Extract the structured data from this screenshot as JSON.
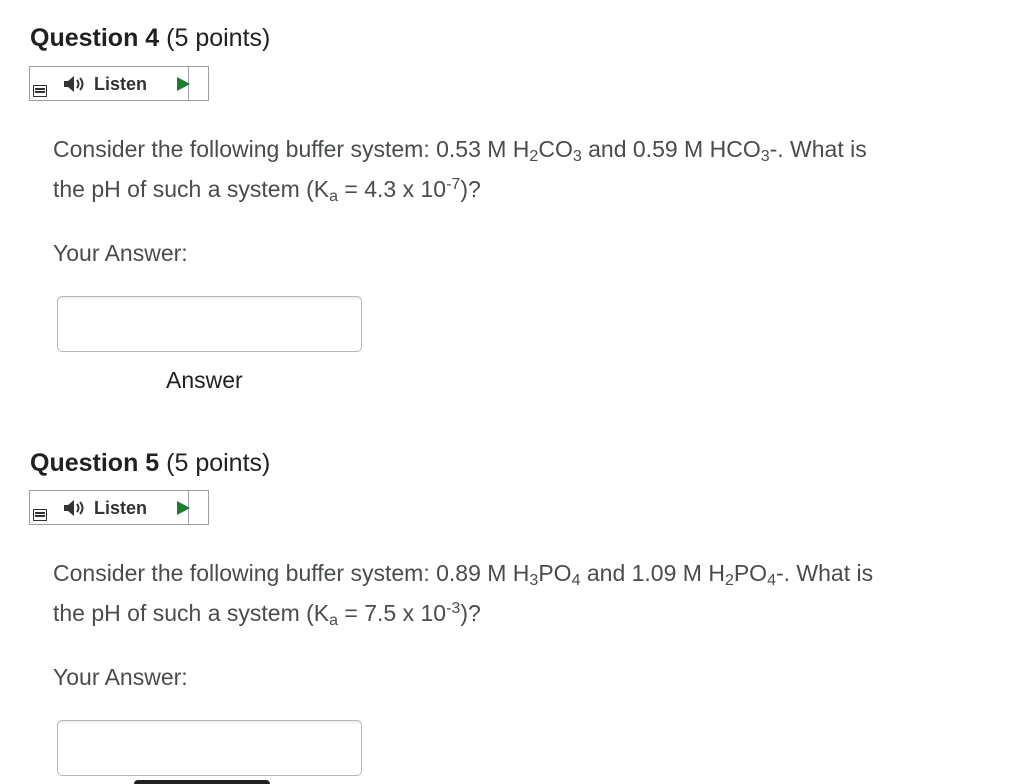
{
  "questions": [
    {
      "title": "Question 4",
      "points": "(5 points)",
      "listen_label": "Listen",
      "text": {
        "intro": "Consider the following buffer system: 0.53 M H",
        "acid_sub1": "2",
        "acid_mid": "CO",
        "acid_sub2": "3",
        "middle": " and 0.59 M HCO",
        "base_sub": "3",
        "after_base": "-. What is",
        "line2_start": "the pH of such a system (K",
        "ka_sub": "a",
        "ka_eq": " = 4.3 x 10",
        "ka_exp": "-7",
        "ka_end": ")?"
      },
      "your_answer_label": "Your Answer:",
      "input_value": "",
      "answer_caption": "Answer"
    },
    {
      "title": "Question 5",
      "points": "(5 points)",
      "listen_label": "Listen",
      "text": {
        "intro": "Consider the following buffer system: 0.89 M H",
        "acid_sub1": "3",
        "acid_mid": "PO",
        "acid_sub2": "4",
        "middle": " and 1.09 M H",
        "base_sub": "2",
        "base_mid": "PO",
        "base_sub2": "4",
        "after_base": "-. What is",
        "line2_start": "the pH of such a system (K",
        "ka_sub": "a",
        "ka_eq": " = 7.5 x 10",
        "ka_exp": "-3",
        "ka_end": ")?"
      },
      "your_answer_label": "Your Answer:",
      "input_value": ""
    }
  ],
  "colors": {
    "play": "#1a7f2c",
    "text": "#494c4e",
    "heading": "#202122",
    "border": "#9aa0a6"
  },
  "icons": {
    "menu": "menu-icon",
    "speaker": "speaker-icon",
    "play": "play-icon"
  }
}
